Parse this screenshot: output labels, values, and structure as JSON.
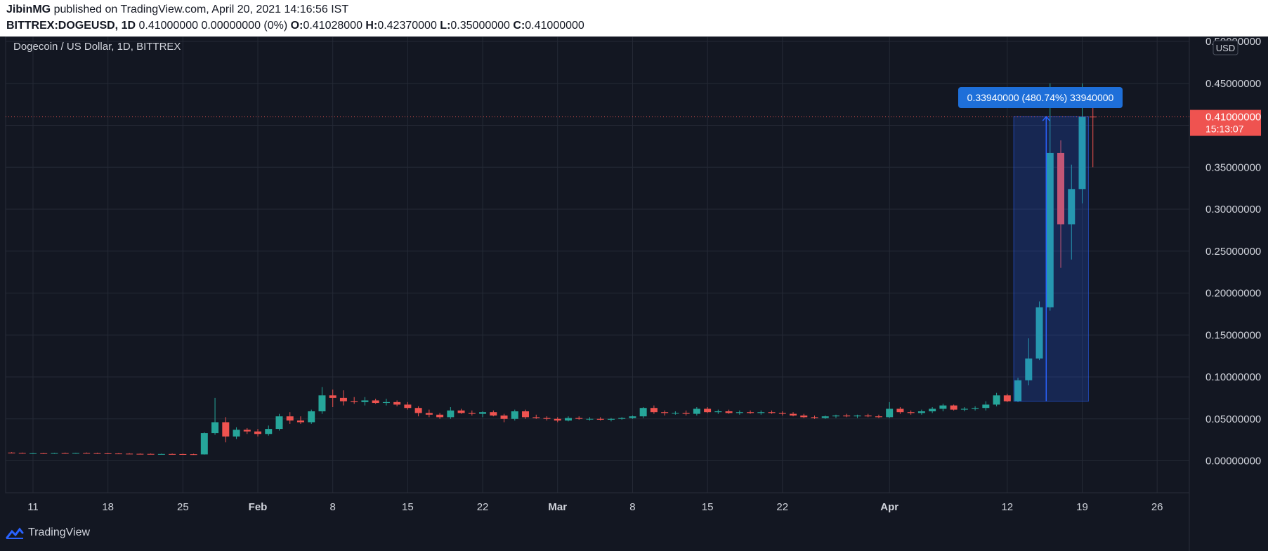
{
  "header": {
    "author": "JibinMG",
    "published_text": "published on TradingView.com, April 20, 2021 14:16:56 IST",
    "symbol": "BITTREX:DOGEUSD, 1D",
    "change": "0.41000000 0.00000000 (0%)",
    "o_label": "O:",
    "o_value": "0.41028000",
    "h_label": "H:",
    "h_value": "0.42370000",
    "l_label": "L:",
    "l_value": "0.35000000",
    "c_label": "C:",
    "c_value": "0.41000000"
  },
  "chart": {
    "legend_title": "Dogecoin / US Dollar, 1D, BITTREX",
    "currency": "USD",
    "last_price_label": "0.41000000",
    "countdown": "15:13:07",
    "measure_label": "0.33940000 (480.74%) 33940000",
    "brand": "TradingView"
  },
  "colors": {
    "background": "#131722",
    "up": "#26a69a",
    "down": "#ef5350",
    "grid": "#252a36",
    "axis_text": "#d1d4dc",
    "measure": "#2962ff"
  },
  "chart_data": {
    "type": "candlestick",
    "title": "Dogecoin / US Dollar, 1D, BITTREX",
    "ylim": [
      -0.04,
      0.5
    ],
    "y_ticks": [
      "0.50000000",
      "0.45000000",
      "0.40000000",
      "0.35000000",
      "0.30000000",
      "0.25000000",
      "0.20000000",
      "0.15000000",
      "0.10000000",
      "0.05000000",
      "0.00000000"
    ],
    "x_ticks": [
      "11",
      "18",
      "25",
      "Feb",
      "8",
      "15",
      "22",
      "Mar",
      "8",
      "15",
      "22",
      "Apr",
      "12",
      "19",
      "26"
    ],
    "start_date": "2021-01-09",
    "ohlc": [
      [
        0.0098,
        0.0102,
        0.009,
        0.0094
      ],
      [
        0.0094,
        0.0098,
        0.0086,
        0.0088
      ],
      [
        0.0088,
        0.0094,
        0.0084,
        0.009
      ],
      [
        0.009,
        0.0095,
        0.0086,
        0.0088
      ],
      [
        0.0088,
        0.0096,
        0.0086,
        0.0092
      ],
      [
        0.0092,
        0.0098,
        0.0088,
        0.009
      ],
      [
        0.009,
        0.0096,
        0.0087,
        0.0093
      ],
      [
        0.0093,
        0.0099,
        0.0089,
        0.0091
      ],
      [
        0.0091,
        0.0097,
        0.0087,
        0.0089
      ],
      [
        0.0089,
        0.0094,
        0.0085,
        0.0087
      ],
      [
        0.0087,
        0.0092,
        0.0083,
        0.0085
      ],
      [
        0.0085,
        0.0091,
        0.0082,
        0.0083
      ],
      [
        0.0083,
        0.0088,
        0.008,
        0.0082
      ],
      [
        0.0082,
        0.0087,
        0.0079,
        0.008
      ],
      [
        0.008,
        0.0086,
        0.0078,
        0.0081
      ],
      [
        0.0081,
        0.0087,
        0.0078,
        0.008
      ],
      [
        0.008,
        0.0085,
        0.0077,
        0.0078
      ],
      [
        0.0078,
        0.0084,
        0.0075,
        0.0076
      ],
      [
        0.0076,
        0.034,
        0.0074,
        0.033
      ],
      [
        0.033,
        0.075,
        0.031,
        0.046
      ],
      [
        0.046,
        0.052,
        0.022,
        0.029
      ],
      [
        0.029,
        0.04,
        0.026,
        0.037
      ],
      [
        0.037,
        0.039,
        0.032,
        0.035
      ],
      [
        0.035,
        0.038,
        0.029,
        0.032
      ],
      [
        0.032,
        0.042,
        0.03,
        0.038
      ],
      [
        0.038,
        0.056,
        0.036,
        0.053
      ],
      [
        0.053,
        0.058,
        0.044,
        0.048
      ],
      [
        0.048,
        0.053,
        0.044,
        0.046
      ],
      [
        0.046,
        0.061,
        0.044,
        0.059
      ],
      [
        0.059,
        0.088,
        0.056,
        0.078
      ],
      [
        0.078,
        0.085,
        0.064,
        0.075
      ],
      [
        0.075,
        0.084,
        0.066,
        0.071
      ],
      [
        0.071,
        0.076,
        0.068,
        0.07
      ],
      [
        0.07,
        0.076,
        0.066,
        0.072
      ],
      [
        0.072,
        0.074,
        0.068,
        0.069
      ],
      [
        0.069,
        0.074,
        0.066,
        0.07
      ],
      [
        0.07,
        0.072,
        0.065,
        0.067
      ],
      [
        0.067,
        0.07,
        0.061,
        0.063
      ],
      [
        0.063,
        0.065,
        0.053,
        0.057
      ],
      [
        0.057,
        0.061,
        0.052,
        0.055
      ],
      [
        0.055,
        0.057,
        0.05,
        0.052
      ],
      [
        0.052,
        0.064,
        0.05,
        0.06
      ],
      [
        0.06,
        0.062,
        0.056,
        0.057
      ],
      [
        0.057,
        0.06,
        0.054,
        0.056
      ],
      [
        0.056,
        0.059,
        0.052,
        0.058
      ],
      [
        0.058,
        0.06,
        0.053,
        0.054
      ],
      [
        0.054,
        0.056,
        0.046,
        0.05
      ],
      [
        0.05,
        0.061,
        0.048,
        0.059
      ],
      [
        0.059,
        0.061,
        0.05,
        0.052
      ],
      [
        0.052,
        0.055,
        0.05,
        0.051
      ],
      [
        0.051,
        0.053,
        0.048,
        0.05
      ],
      [
        0.05,
        0.052,
        0.046,
        0.048
      ],
      [
        0.048,
        0.053,
        0.047,
        0.051
      ],
      [
        0.051,
        0.053,
        0.049,
        0.05
      ],
      [
        0.05,
        0.052,
        0.048,
        0.05
      ],
      [
        0.05,
        0.052,
        0.048,
        0.049
      ],
      [
        0.049,
        0.051,
        0.047,
        0.05
      ],
      [
        0.05,
        0.052,
        0.049,
        0.051
      ],
      [
        0.051,
        0.054,
        0.05,
        0.053
      ],
      [
        0.053,
        0.064,
        0.051,
        0.063
      ],
      [
        0.063,
        0.066,
        0.056,
        0.058
      ],
      [
        0.058,
        0.06,
        0.054,
        0.057
      ],
      [
        0.057,
        0.059,
        0.055,
        0.057
      ],
      [
        0.057,
        0.06,
        0.054,
        0.056
      ],
      [
        0.056,
        0.064,
        0.054,
        0.062
      ],
      [
        0.062,
        0.064,
        0.057,
        0.058
      ],
      [
        0.058,
        0.061,
        0.056,
        0.059
      ],
      [
        0.059,
        0.061,
        0.056,
        0.057
      ],
      [
        0.057,
        0.06,
        0.055,
        0.058
      ],
      [
        0.058,
        0.06,
        0.056,
        0.057
      ],
      [
        0.057,
        0.06,
        0.055,
        0.058
      ],
      [
        0.058,
        0.06,
        0.056,
        0.057
      ],
      [
        0.057,
        0.059,
        0.054,
        0.056
      ],
      [
        0.056,
        0.058,
        0.053,
        0.054
      ],
      [
        0.054,
        0.056,
        0.051,
        0.052
      ],
      [
        0.052,
        0.054,
        0.05,
        0.051
      ],
      [
        0.051,
        0.054,
        0.05,
        0.053
      ],
      [
        0.053,
        0.055,
        0.051,
        0.054
      ],
      [
        0.054,
        0.056,
        0.052,
        0.053
      ],
      [
        0.053,
        0.055,
        0.051,
        0.054
      ],
      [
        0.054,
        0.056,
        0.052,
        0.053
      ],
      [
        0.053,
        0.055,
        0.051,
        0.052
      ],
      [
        0.052,
        0.07,
        0.051,
        0.062
      ],
      [
        0.062,
        0.064,
        0.056,
        0.058
      ],
      [
        0.058,
        0.06,
        0.055,
        0.057
      ],
      [
        0.057,
        0.061,
        0.055,
        0.059
      ],
      [
        0.059,
        0.064,
        0.057,
        0.062
      ],
      [
        0.062,
        0.068,
        0.059,
        0.066
      ],
      [
        0.066,
        0.067,
        0.06,
        0.061
      ],
      [
        0.061,
        0.064,
        0.059,
        0.062
      ],
      [
        0.062,
        0.065,
        0.06,
        0.063
      ],
      [
        0.063,
        0.071,
        0.06,
        0.067
      ],
      [
        0.067,
        0.081,
        0.065,
        0.078
      ],
      [
        0.078,
        0.08,
        0.07,
        0.071
      ],
      [
        0.071,
        0.099,
        0.07,
        0.096
      ],
      [
        0.096,
        0.146,
        0.09,
        0.122
      ],
      [
        0.122,
        0.19,
        0.12,
        0.183
      ],
      [
        0.183,
        0.45,
        0.179,
        0.367
      ],
      [
        0.367,
        0.382,
        0.23,
        0.282
      ],
      [
        0.282,
        0.353,
        0.24,
        0.324
      ],
      [
        0.324,
        0.45,
        0.307,
        0.41
      ],
      [
        0.4103,
        0.4237,
        0.35,
        0.41
      ]
    ],
    "measure": {
      "from": 0.071,
      "to": 0.4104,
      "start_date": "2021-04-13",
      "end_date": "2021-04-19"
    }
  }
}
